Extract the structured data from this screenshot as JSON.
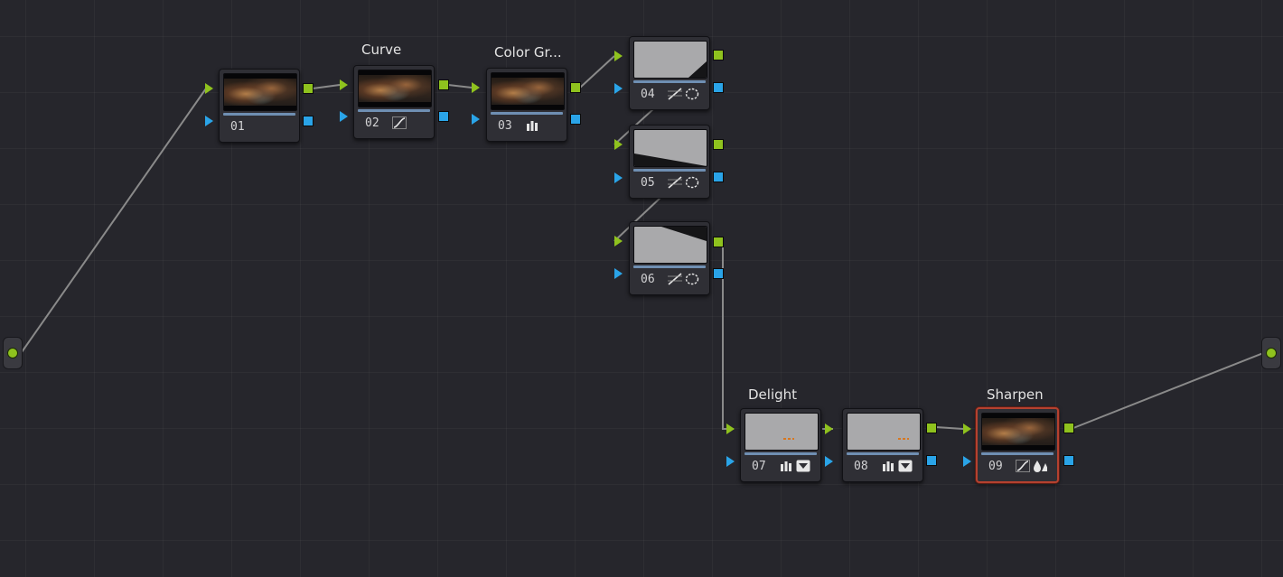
{
  "canvas": {
    "background": "#26262c",
    "link_color": "#8a8a8a",
    "accent_green": "#8fc21e",
    "accent_blue": "#2aa4e8",
    "selection_color": "#b5412f"
  },
  "nodes": [
    {
      "id": "01",
      "label": "",
      "thumb": "image",
      "tools": []
    },
    {
      "id": "02",
      "label": "Curve",
      "thumb": "image",
      "tools": [
        "curve-icon"
      ]
    },
    {
      "id": "03",
      "label": "Color Gr...",
      "thumb": "image",
      "tools": [
        "bars-icon"
      ]
    },
    {
      "id": "04",
      "label": "",
      "thumb": "gray",
      "tools": [
        "curve-icon",
        "circle-icon"
      ]
    },
    {
      "id": "05",
      "label": "",
      "thumb": "gray",
      "tools": [
        "curve-icon",
        "circle-icon"
      ]
    },
    {
      "id": "06",
      "label": "",
      "thumb": "gray",
      "tools": [
        "curve-icon",
        "circle-icon"
      ]
    },
    {
      "id": "07",
      "label": "Delight",
      "thumb": "gray",
      "tools": [
        "bars-icon",
        "key-icon"
      ]
    },
    {
      "id": "08",
      "label": "",
      "thumb": "gray",
      "tools": [
        "bars-icon",
        "key-icon"
      ]
    },
    {
      "id": "09",
      "label": "Sharpen",
      "thumb": "image",
      "tools": [
        "curve-icon",
        "blur-icon"
      ],
      "selected": true
    }
  ],
  "endpoints": {
    "input": "source-input-icon",
    "output": "node-output-icon"
  }
}
